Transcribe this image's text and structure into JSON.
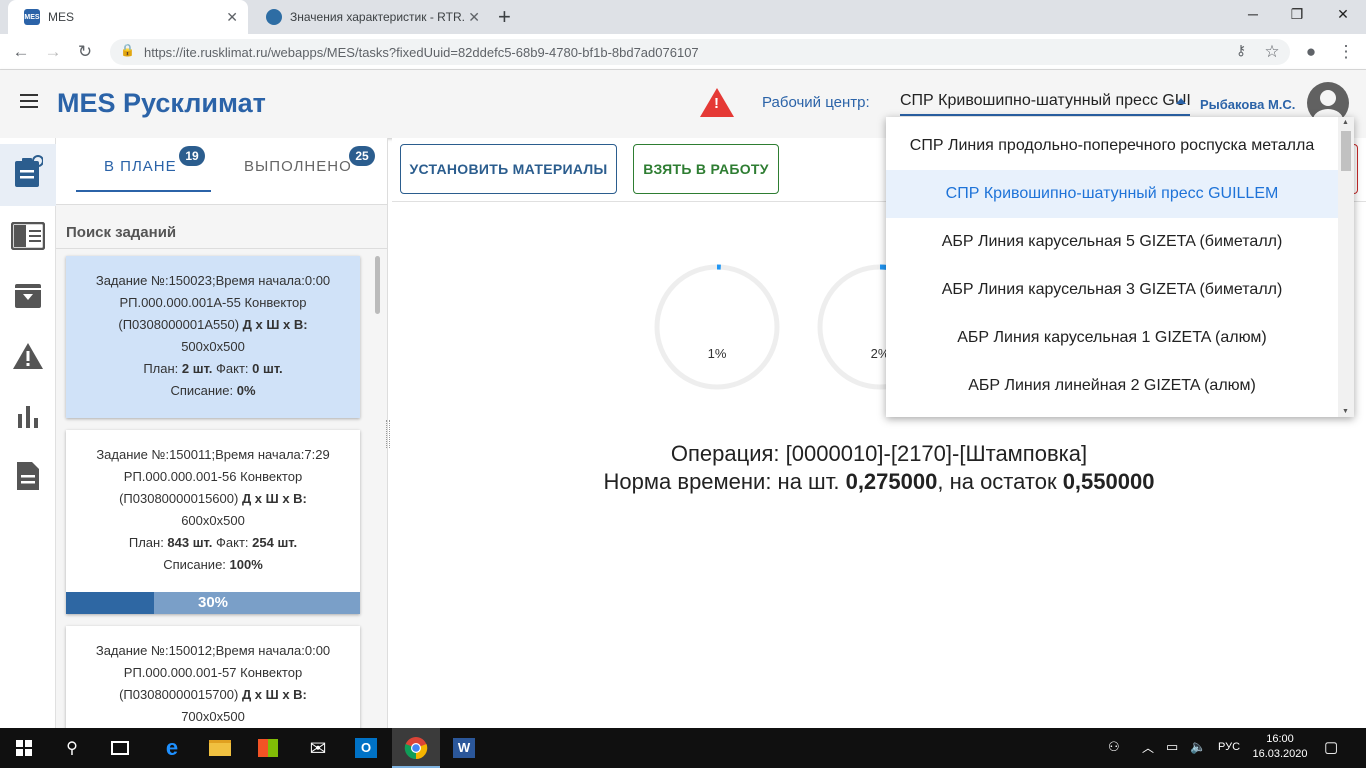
{
  "browser": {
    "tabs": [
      {
        "title": "MES",
        "favicon": "MES"
      },
      {
        "title": "Значения характеристик - RTR."
      }
    ],
    "url": "https://ite.rusklimat.ru/webapps/MES/tasks?fixedUuid=82ddefc5-68b9-4780-bf1b-8bd7ad076107"
  },
  "header": {
    "title": "MES Русклимат",
    "work_center_label": "Рабочий центр:",
    "work_center_value": "СПР Кривошипно-шатунный пресс GUILLEM",
    "user": "Рыбакова М.С."
  },
  "tabs": {
    "plan_label": "В ПЛАНЕ",
    "plan_count": "19",
    "done_label": "ВЫПОЛНЕНО",
    "done_count": "25"
  },
  "search_label": "Поиск заданий",
  "tasks": [
    {
      "line1": "Задание №:150023;Время начала:0:00",
      "line2": "РП.000.000.001А-55 Конвектор",
      "line3a": "(П0308000001А550) ",
      "dims_label": "Д х Ш х В:",
      "dims": "500х0х500",
      "plan_label": "План: ",
      "plan": "2 шт.",
      "fact_label": " Факт: ",
      "fact": "0 шт.",
      "writeoff_label": "Списание: ",
      "writeoff": "0%"
    },
    {
      "line1": "Задание №:150011;Время начала:7:29",
      "line2": "РП.000.000.001-56 Конвектор",
      "line3a": "(П03080000015600) ",
      "dims_label": "Д х Ш х В:",
      "dims": "600х0х500",
      "plan_label": "План: ",
      "plan": "843 шт.",
      "fact_label": " Факт: ",
      "fact": "254 шт.",
      "writeoff_label": "Списание: ",
      "writeoff": "100%",
      "progress_label": "30%",
      "progress": 0.3
    },
    {
      "line1": "Задание №:150012;Время начала:0:00",
      "line2": "РП.000.000.001-57 Конвектор",
      "line3a": "(П03080000015700) ",
      "dims_label": "Д х Ш х В:",
      "dims": "700х0х500"
    }
  ],
  "toolbar": {
    "install_materials": "УСТАНОВИТЬ МАТЕРИАЛЫ",
    "take_to_work": "ВЗЯТЬ В РАБОТУ"
  },
  "gauges": [
    {
      "label": "1%",
      "value": 0.01
    },
    {
      "label": "2%",
      "value": 0.02
    }
  ],
  "operation": {
    "text": "Операция: [0000010]-[2170]-[Штамповка]",
    "norm_prefix": "Норма времени: на шт. ",
    "norm_piece": "0,275000",
    "norm_mid": ", на остаток ",
    "norm_rest": "0,550000"
  },
  "dropdown_options": [
    "СПР Линия продольно-поперечного роспуска металла",
    "СПР Кривошипно-шатунный пресс GUILLEM",
    "АБР Линия карусельная 5 GIZETA (биметалл)",
    "АБР Линия карусельная 3 GIZETA (биметалл)",
    "АБР Линия карусельная 1 GIZETA (алюм)",
    "АБР Линия линейная 2 GIZETA (алюм)"
  ],
  "taskbar": {
    "lang": "РУС",
    "time": "16:00",
    "date": "16.03.2020"
  },
  "colors": {
    "brand": "#2b63a8",
    "success": "#2e7d32",
    "warning": "#e53935"
  }
}
